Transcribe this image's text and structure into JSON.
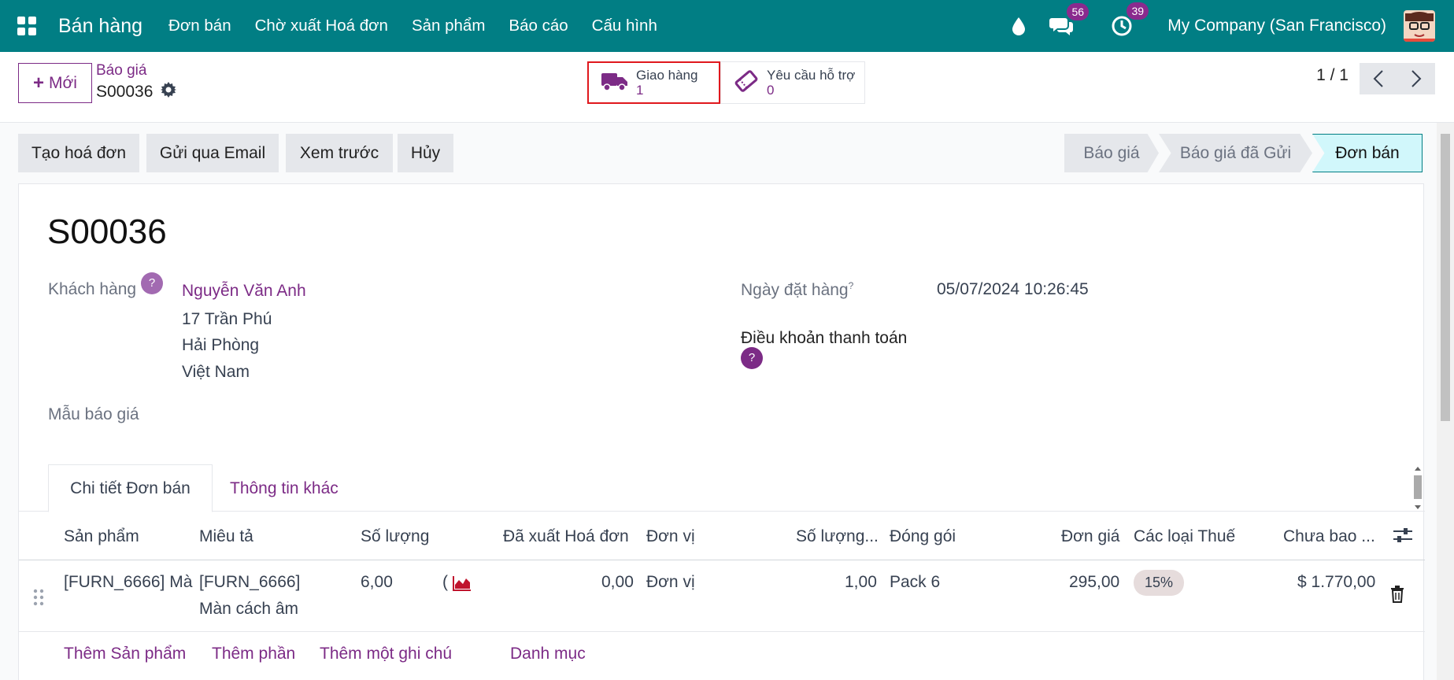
{
  "navbar": {
    "brand": "Bán hàng",
    "menu": [
      "Đơn bán",
      "Chờ xuất Hoá đơn",
      "Sản phẩm",
      "Báo cáo",
      "Cấu hình"
    ],
    "messages_count": "56",
    "activities_count": "39",
    "company": "My Company (San Francisco)"
  },
  "control": {
    "new_label": "Mới",
    "breadcrumb_parent": "Báo giá",
    "breadcrumb_current": "S00036",
    "delivery_label": "Giao hàng",
    "delivery_count": "1",
    "ticket_label": "Yêu cầu hỗ trợ",
    "ticket_count": "0",
    "pager": "1 / 1"
  },
  "actions": [
    "Tạo hoá đơn",
    "Gửi qua Email",
    "Xem trước",
    "Hủy"
  ],
  "statusbar": [
    "Báo giá",
    "Báo giá đã Gửi",
    "Đơn bán"
  ],
  "form": {
    "title": "S00036",
    "customer_label": "Khách hàng",
    "customer_name": "Nguyễn Văn Anh",
    "address_line1": "17 Trần Phú",
    "address_line2": "Hải Phòng",
    "address_line3": "Việt Nam",
    "template_label": "Mẫu báo giá",
    "order_date_label": "Ngày đặt hàng",
    "order_date_sup": "?",
    "order_date": "05/07/2024 10:26:45",
    "payment_terms_label": "Điều khoản thanh toán",
    "help_mark": "?"
  },
  "tabs": [
    "Chi tiết Đơn bán",
    "Thông tin khác"
  ],
  "table": {
    "headers": [
      "Sản phẩm",
      "Miêu tả",
      "Số lượng",
      "Đã xuất Hoá đơn",
      "Đơn vị",
      "Số lượng...",
      "Đóng gói",
      "Đơn giá",
      "Các loại Thuế",
      "Chưa bao ..."
    ],
    "row": {
      "product": "[FURN_6666] Mà",
      "desc_line1": "[FURN_6666]",
      "desc_line2": "Màn cách âm",
      "qty": "6,00",
      "qty_cut": "(",
      "invoiced": "0,00",
      "uom": "Đơn vị",
      "pkg_qty": "1,00",
      "packaging": "Pack 6",
      "price": "295,00",
      "tax": "15%",
      "subtotal": "$ 1.770,00"
    },
    "add_links": [
      "Thêm Sản phẩm",
      "Thêm phần",
      "Thêm một ghi chú",
      "Danh mục"
    ]
  },
  "colors": {
    "navbar": "#017e84",
    "accent": "#7c2b86",
    "highlight": "#e0181d"
  }
}
